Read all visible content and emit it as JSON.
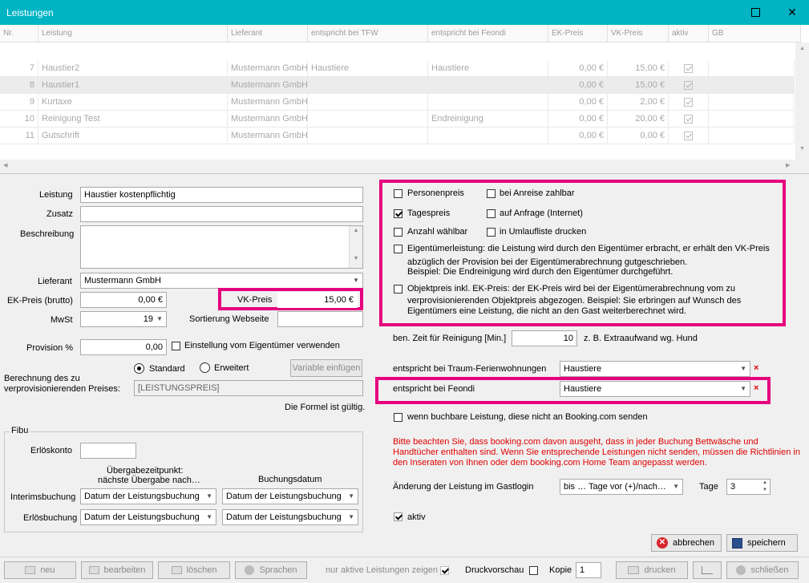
{
  "window": {
    "title": "Leistungen",
    "maximize_icon": "maximize-icon",
    "close_icon": "close-icon"
  },
  "grid": {
    "headers": [
      "Nr.",
      "Leistung",
      "Lieferant",
      "entspricht bei TFW",
      "entspricht bei Feondi",
      "EK-Preis",
      "VK-Preis",
      "aktiv",
      "GB"
    ],
    "rows": [
      {
        "nr": "7",
        "leistung": "Haustier2",
        "lieferant": "Mustermann GmbH",
        "tfw": "Haustiere",
        "feondi": "Haustiere",
        "ek": "0,00 €",
        "vk": "15,00 €",
        "aktiv": true
      },
      {
        "nr": "8",
        "leistung": "Haustier1",
        "lieferant": "Mustermann GmbH",
        "tfw": "",
        "feondi": "",
        "ek": "0,00 €",
        "vk": "15,00 €",
        "aktiv": true
      },
      {
        "nr": "9",
        "leistung": "Kurtaxe",
        "lieferant": "Mustermann GmbH",
        "tfw": "",
        "feondi": "",
        "ek": "0,00 €",
        "vk": "2,00 €",
        "aktiv": true
      },
      {
        "nr": "10",
        "leistung": "Reinigung Test",
        "lieferant": "Mustermann GmbH",
        "tfw": "",
        "feondi": "Endreinigung",
        "ek": "0,00 €",
        "vk": "20,00 €",
        "aktiv": true
      },
      {
        "nr": "11",
        "leistung": "Gutschrift",
        "lieferant": "Mustermann GmbH",
        "tfw": "",
        "feondi": "",
        "ek": "0,00 €",
        "vk": "0,00 €",
        "aktiv": true
      }
    ]
  },
  "form": {
    "leistung_label": "Leistung",
    "leistung_value": "Haustier kostenpflichtig",
    "zusatz_label": "Zusatz",
    "zusatz_value": "",
    "beschreibung_label": "Beschreibung",
    "beschreibung_value": "",
    "lieferant_label": "Lieferant",
    "lieferant_value": "Mustermann GmbH",
    "ek_label": "EK-Preis (brutto)",
    "ek_value": "0,00 €",
    "vk_label": "VK-Preis",
    "vk_value": "15,00 €",
    "mwst_label": "MwSt",
    "mwst_value": "19",
    "sortierung_label": "Sortierung Webseite",
    "sortierung_value": "",
    "provision_label": "Provision %",
    "provision_value": "0,00",
    "einstellung_label": "Einstellung vom Eigentümer verwenden",
    "berechnung_label1": "Berechnung des zu",
    "berechnung_label2": "verprovisionierenden Preises:",
    "standard_label": "Standard",
    "erweitert_label": "Erweitert",
    "variable_button": "Variable einfügen",
    "formel_value": "[LEISTUNGSPREIS]",
    "formel_status": "Die Formel ist gültig."
  },
  "fibu": {
    "title": "Fibu",
    "erloeskonto_label": "Erlöskonto",
    "erloeskonto_value": "",
    "uebergabe_header1": "Übergabezeitpunkt:",
    "uebergabe_header2": "nächste Übergabe nach…",
    "buchungsdatum_header": "Buchungsdatum",
    "interims_label": "Interimsbuchung",
    "erloes_label": "Erlösbuchung",
    "select_value": "Datum der Leistungsbuchung"
  },
  "options": {
    "personenpreis": "Personenpreis",
    "anreise": "bei Anreise zahlbar",
    "tagespreis": "Tagespreis",
    "anfrage": "auf Anfrage (Internet)",
    "anzahl": "Anzahl wählbar",
    "umlauf": "in Umlaufliste drucken",
    "eigentuemer1": "Eigentümerleistung: die Leistung wird durch den Eigentümer erbracht, er erhält den VK-Preis",
    "eigentuemer2": "abzüglich der Provision bei der Eigentümerabrechnung gutgeschrieben.",
    "eigentuemer3": "Beispiel: Die Endreinigung wird durch den Eigentümer durchgeführt.",
    "objekt1": "Objektpreis inkl. EK-Preis: der EK-Preis wird bei der Eigentümerabrechnung vom zu",
    "objekt2": "verprovisionierenden Objektpreis abgezogen. Beispiel: Sie erbringen auf Wunsch des",
    "objekt3": "Eigentümers eine Leistung, die nicht an den Gast weiterberechnet wird."
  },
  "right": {
    "reinigung_label": "ben. Zeit für Reinigung [Min.]",
    "reinigung_value": "10",
    "reinigung_hint": "z. B. Extraaufwand wg. Hund",
    "traum_label": "entspricht bei Traum-Ferienwohnungen",
    "traum_value": "Haustiere",
    "feondi_label": "entspricht bei Feondi",
    "feondi_value": "Haustiere",
    "booking_label": "wenn buchbare Leistung, diese nicht an Booking.com senden",
    "warn1": "Bitte beachten Sie, dass booking.com davon ausgeht, dass in jeder Buchung Bettwäsche und",
    "warn2": "Handtücher enthalten sind. Wenn Sie entsprechende Leistungen nicht senden, müssen die Richtlinien in",
    "warn3": "den Inseraten von Ihnen oder dem booking.com Home Team angepasst werden.",
    "gastlogin_label": "Änderung der Leistung im Gastlogin",
    "gastlogin_value": "bis … Tage vor (+)/nach…",
    "tage_label": "Tage",
    "tage_value": "3",
    "aktiv_label": "aktiv",
    "abbrechen": "abbrechen",
    "speichern": "speichern"
  },
  "toolbar": {
    "neu": "neu",
    "bearbeiten": "bearbeiten",
    "loeschen": "löschen",
    "sprachen": "Sprachen",
    "nur_aktive": "nur aktive Leistungen zeigen",
    "druckvorschau": "Druckvorschau",
    "kopie_label": "Kopie",
    "kopie_value": "1",
    "drucken": "drucken",
    "schliessen": "schließen"
  },
  "colors": {
    "titlebar": "#00b4c4",
    "highlight": "#e6007e",
    "warning": "#e00000"
  }
}
